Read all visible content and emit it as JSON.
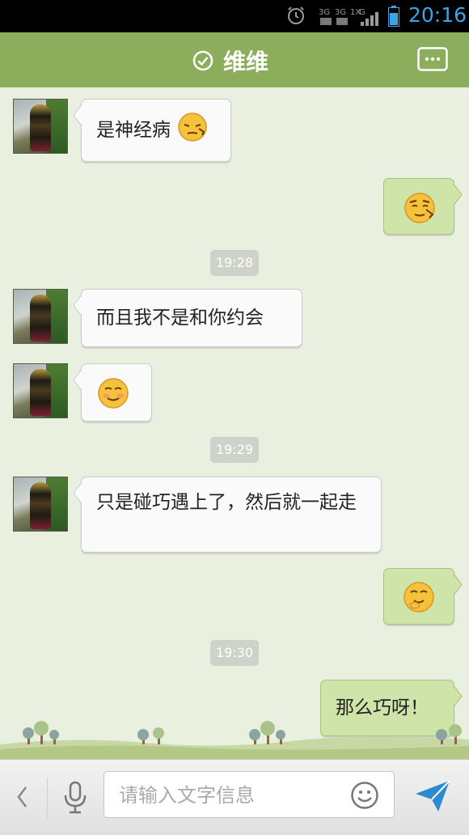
{
  "status_bar": {
    "time": "20:16",
    "network_labels": [
      "3G",
      "3G",
      "1X",
      "G"
    ],
    "accent_color": "#3aa5e6"
  },
  "header": {
    "contact_name": "维维",
    "online_icon": "check-circle-icon",
    "menu_icon": "more-icon"
  },
  "messages": [
    {
      "side": "left",
      "text": "是神经病",
      "emoji": "shush-emoji"
    },
    {
      "side": "right",
      "text": "",
      "emoji": "smirk-emoji"
    },
    {
      "type": "time",
      "text": "19:28"
    },
    {
      "side": "left",
      "text": "而且我不是和你约会",
      "emoji": ""
    },
    {
      "side": "left",
      "text": "",
      "emoji": "content-emoji"
    },
    {
      "type": "time",
      "text": "19:29"
    },
    {
      "side": "left",
      "text": "只是碰巧遇上了，然后就一起走",
      "emoji": ""
    },
    {
      "side": "right",
      "text": "",
      "emoji": "giggle-emoji"
    },
    {
      "type": "time",
      "text": "19:30"
    },
    {
      "side": "right",
      "text": "那么巧呀！",
      "emoji": ""
    }
  ],
  "input": {
    "placeholder": "请输入文字信息",
    "value": ""
  }
}
